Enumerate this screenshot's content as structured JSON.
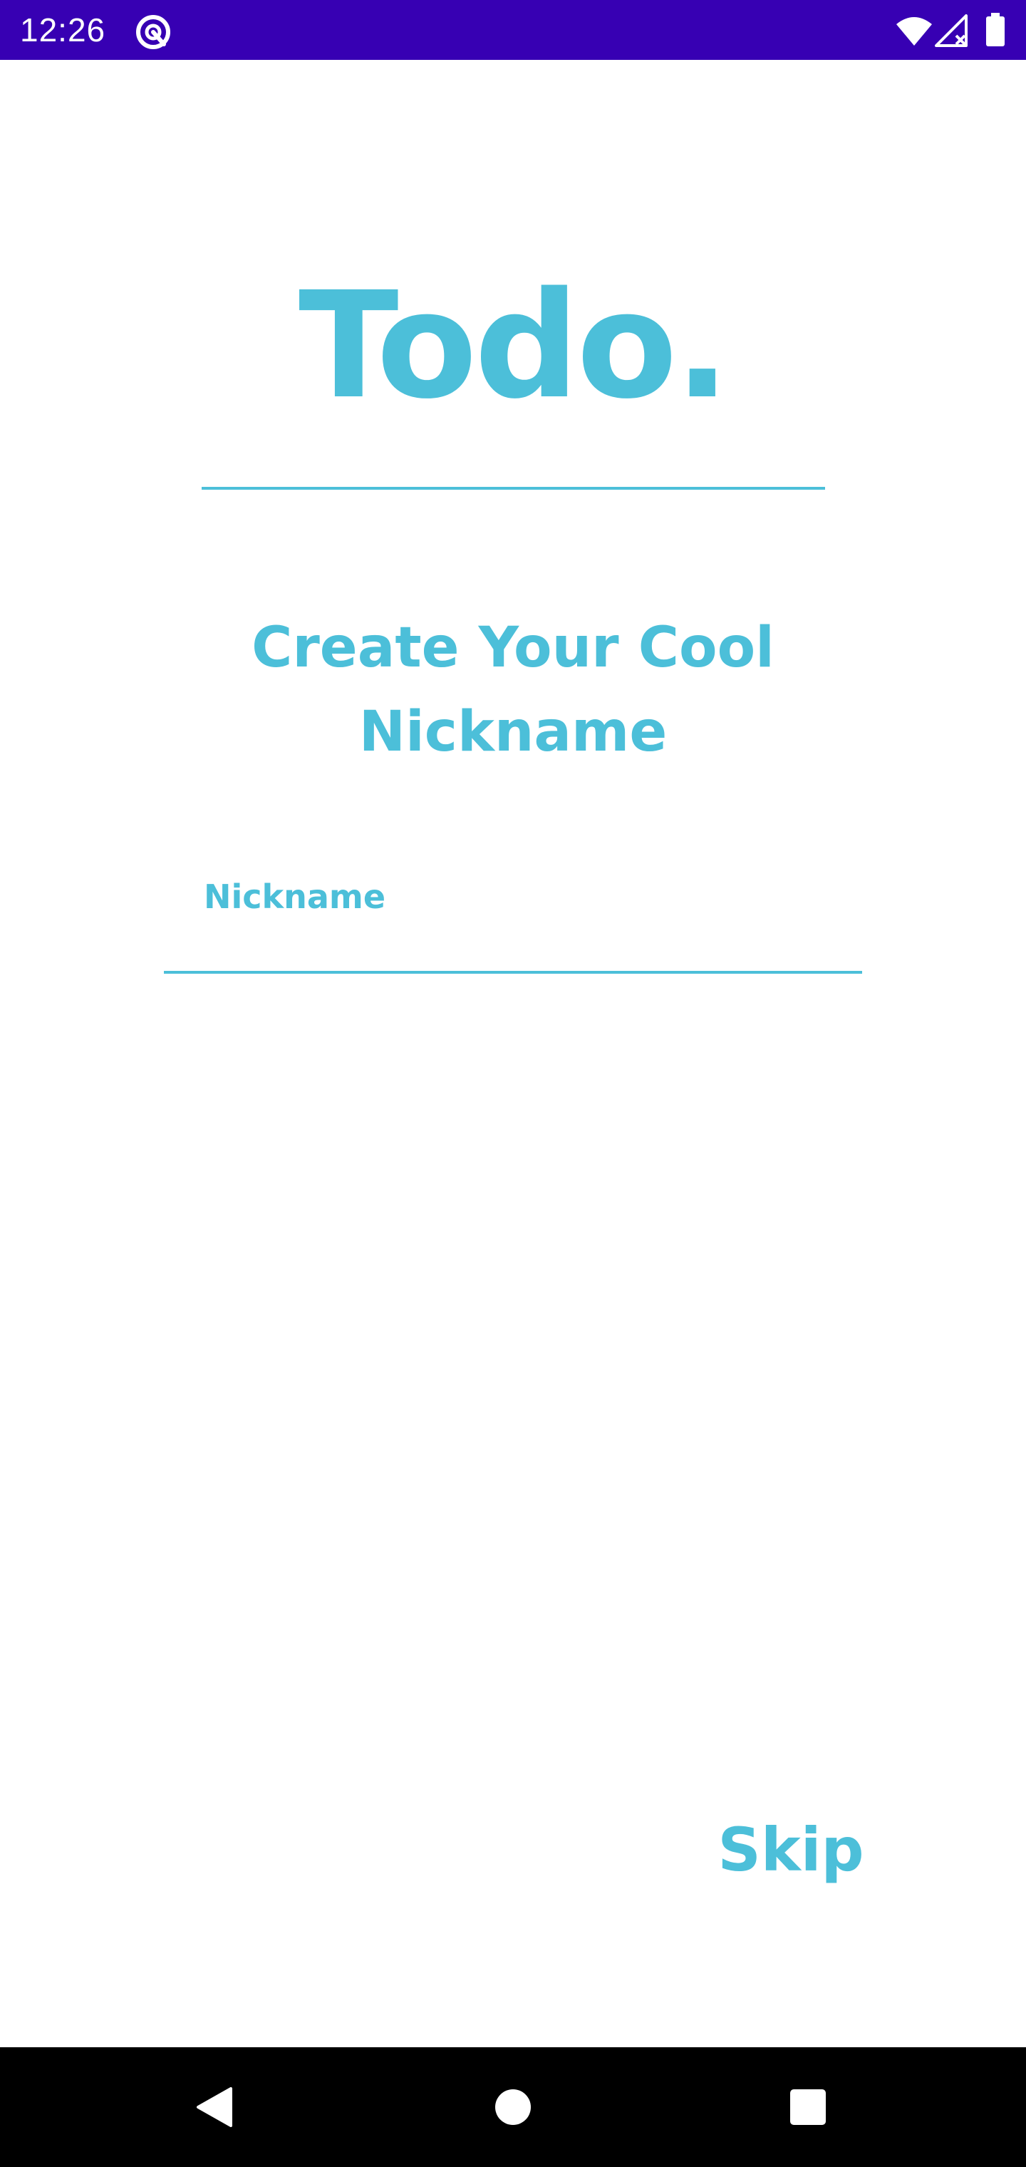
{
  "status_bar": {
    "time": "12:26",
    "background_color": "#3700B3",
    "icons": [
      "app-notification-icon",
      "wifi-icon",
      "cell-signal-icon",
      "battery-icon"
    ]
  },
  "app": {
    "title": "Todo.",
    "accent_color": "#4CBFD9"
  },
  "form": {
    "heading": "Create Your Cool Nickname",
    "nickname_label": "Nickname",
    "nickname_value": ""
  },
  "actions": {
    "skip_label": "Skip"
  },
  "nav_bar": {
    "icons": [
      "back-icon",
      "home-icon",
      "recents-icon"
    ]
  }
}
